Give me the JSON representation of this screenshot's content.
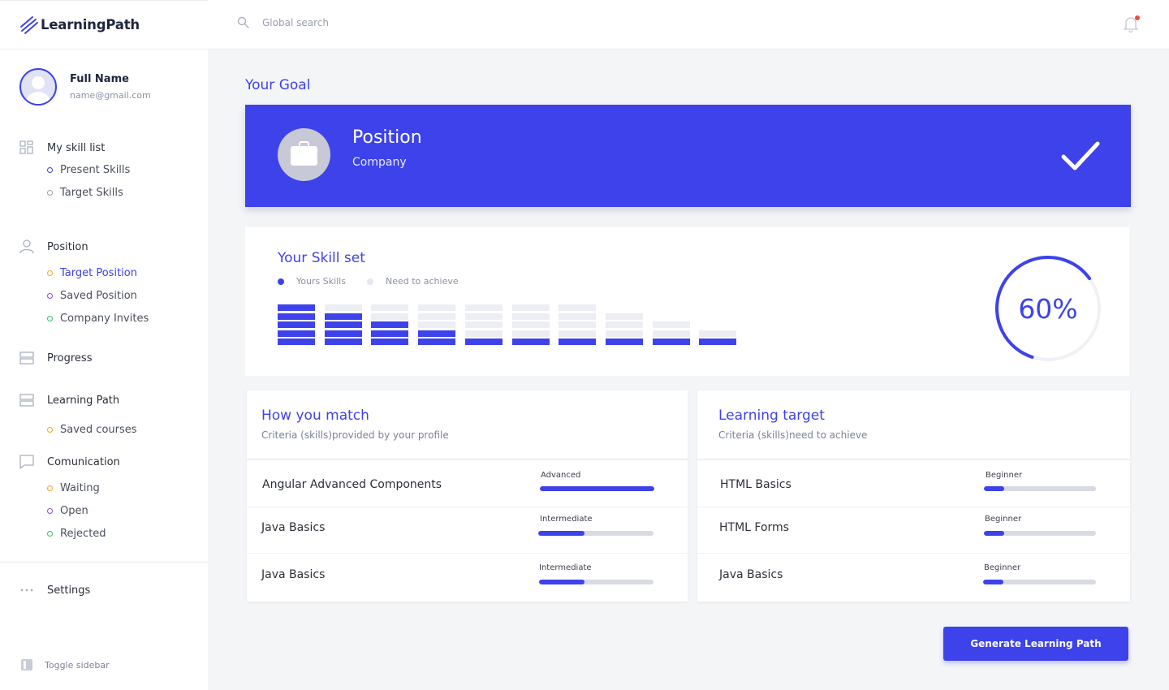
{
  "brand": {
    "name": "LearningPath"
  },
  "topbar": {
    "search_placeholder": "Global search"
  },
  "profile": {
    "name": "Full Name",
    "email": "name@gmail.com"
  },
  "sidebar": {
    "skill_list": {
      "label": "My skill list",
      "items": [
        "Present Skills",
        "Target Skills"
      ]
    },
    "position": {
      "label": "Position",
      "items": [
        "Target Position",
        "Saved Position",
        "Company Invites"
      ]
    },
    "progress": {
      "label": "Progress"
    },
    "learning_path": {
      "label": "Learning Path",
      "items": [
        "Saved courses"
      ]
    },
    "communication": {
      "label": "Comunication",
      "items": [
        "Waiting",
        "Open",
        "Rejected"
      ]
    },
    "settings": {
      "label": "Settings"
    },
    "toggle": {
      "label": "Toggle sidebar"
    }
  },
  "goal": {
    "title": "Your Goal",
    "position": "Position",
    "company": "Company"
  },
  "skill_set": {
    "title": "Your Skill set",
    "legend": [
      "Yours Skills",
      "Need to achieve"
    ],
    "percent": "60%",
    "percent_value": 0.6,
    "columns": [
      {
        "total": 5,
        "filled": 5
      },
      {
        "total": 5,
        "filled": 4
      },
      {
        "total": 5,
        "filled": 3
      },
      {
        "total": 5,
        "filled": 2
      },
      {
        "total": 5,
        "filled": 1
      },
      {
        "total": 5,
        "filled": 1
      },
      {
        "total": 5,
        "filled": 1
      },
      {
        "total": 4,
        "filled": 1
      },
      {
        "total": 3,
        "filled": 1
      },
      {
        "total": 2,
        "filled": 1
      }
    ],
    "colors": {
      "filled": "#3d42eb",
      "empty": "#eceef4"
    }
  },
  "match": {
    "title": "How you match",
    "subtitle": "Criteria (skills)provided by your profile",
    "rows": [
      {
        "name": "Angular Advanced Components",
        "level": "Advanced",
        "progress": 1.0
      },
      {
        "name": "Java Basics",
        "level": "Intermediate",
        "progress": 0.4
      },
      {
        "name": "Java Basics",
        "level": "Intermediate",
        "progress": 0.4
      }
    ]
  },
  "target": {
    "title": "Learning target",
    "subtitle": "Criteria (skills)need to achieve",
    "rows": [
      {
        "name": "HTML Basics",
        "level": "Beginner",
        "progress": 0.18
      },
      {
        "name": "HTML Forms",
        "level": "Beginner",
        "progress": 0.18
      },
      {
        "name": "Java Basics",
        "level": "Beginner",
        "progress": 0.18
      }
    ]
  },
  "actions": {
    "generate": "Generate Learning Path"
  },
  "accent": "#3d42eb"
}
